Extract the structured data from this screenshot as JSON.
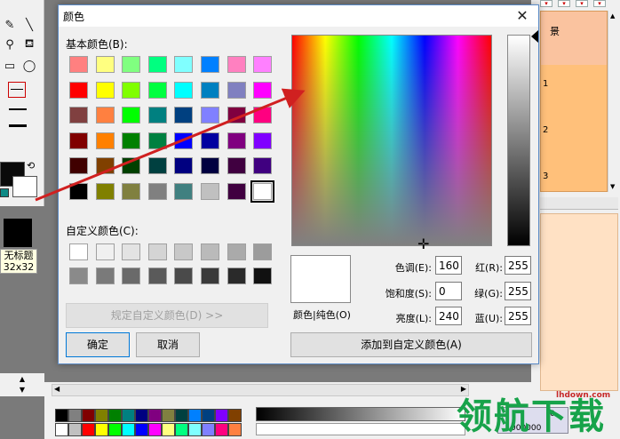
{
  "dialog": {
    "title": "颜色",
    "close_glyph": "✕",
    "basic_colors_label": "基本颜色(B):",
    "custom_colors_label": "自定义颜色(C):",
    "define_custom_label": "规定自定义颜色(D) >>",
    "ok_label": "确定",
    "cancel_label": "取消",
    "add_custom_label": "添加到自定义颜色(A)",
    "preview_label": "颜色|纯色(O)",
    "fields": {
      "hue_label": "色调(E):",
      "hue_value": "160",
      "sat_label": "饱和度(S):",
      "sat_value": "0",
      "lum_label": "亮度(L):",
      "lum_value": "240",
      "red_label": "红(R):",
      "red_value": "255",
      "green_label": "绿(G):",
      "green_value": "255",
      "blue_label": "蓝(U):",
      "blue_value": "255"
    },
    "basic_colors": [
      "#ff8080",
      "#ffff80",
      "#80ff80",
      "#00ff80",
      "#80ffff",
      "#0080ff",
      "#ff80c0",
      "#ff80ff",
      "#ff0000",
      "#ffff00",
      "#80ff00",
      "#00ff40",
      "#00ffff",
      "#0080c0",
      "#8080c0",
      "#ff00ff",
      "#804040",
      "#ff8040",
      "#00ff00",
      "#008080",
      "#004080",
      "#8080ff",
      "#800040",
      "#ff0080",
      "#800000",
      "#ff8000",
      "#008000",
      "#008040",
      "#0000ff",
      "#0000a0",
      "#800080",
      "#8000ff",
      "#400000",
      "#804000",
      "#004000",
      "#004040",
      "#000080",
      "#000040",
      "#400040",
      "#400080",
      "#000000",
      "#808000",
      "#808040",
      "#808080",
      "#408080",
      "#c0c0c0",
      "#400040",
      "#ffffff"
    ],
    "custom_colors": [
      "#ffffff",
      "#f0f0f0",
      "#e3e3e3",
      "#d4d4d4",
      "#c8c8c8",
      "#bababa",
      "#aaaaaa",
      "#9c9c9c",
      "#8a8a8a",
      "#7a7a7a",
      "#6a6a6a",
      "#5a5a5a",
      "#4a4a4a",
      "#3a3a3a",
      "#2a2a2a",
      "#111111"
    ]
  },
  "background_app": {
    "thumbnail_label": "无标题",
    "thumbnail_size": "32x32",
    "layer_header": "景",
    "layers": [
      "1",
      "2",
      "3"
    ],
    "bottom_palette": [
      "#000000",
      "#808080",
      "#800000",
      "#808000",
      "#008000",
      "#008080",
      "#000080",
      "#800080",
      "#808040",
      "#004040",
      "#0080ff",
      "#004080",
      "#8000ff",
      "#804000",
      "#ffffff",
      "#c0c0c0",
      "#ff0000",
      "#ffff00",
      "#00ff00",
      "#00ffff",
      "#0000ff",
      "#ff00ff",
      "#ffff80",
      "#00ff80",
      "#80ffff",
      "#8080ff",
      "#ff0080",
      "#ff8040"
    ],
    "readout_top": "0",
    "readout_bottom": "000000"
  },
  "watermark": {
    "text": "领航下载",
    "url": "lhdown.com"
  },
  "annotation_color": "#d02020"
}
